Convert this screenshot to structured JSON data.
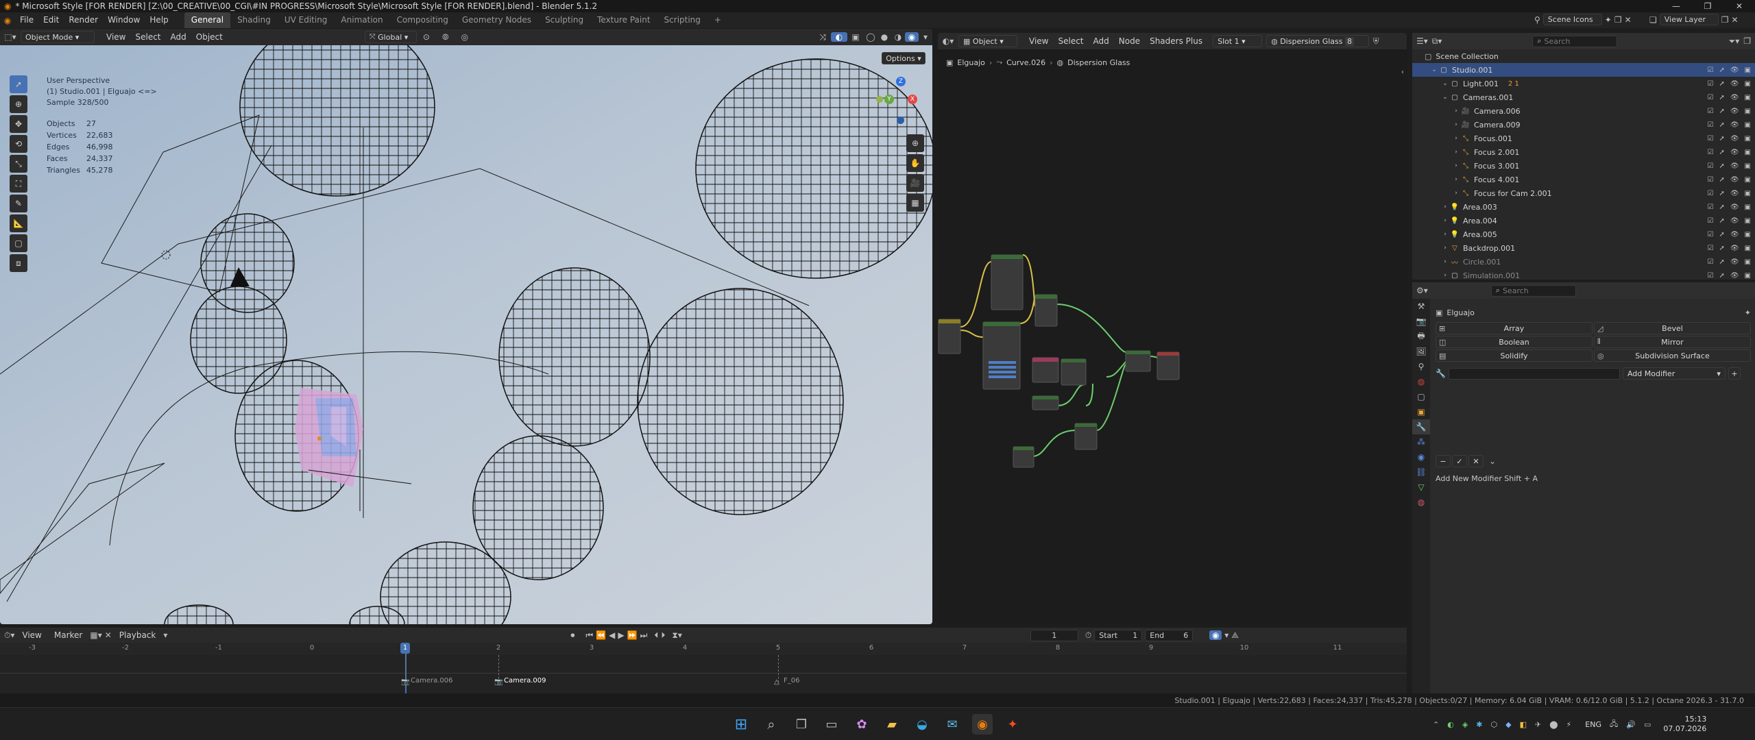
{
  "window": {
    "title": "* Microsoft Style [FOR RENDER] [Z:\\00_CREATIVE\\00_CGI\\#IN PROGRESS\\Microsoft Style\\Microsoft Style [FOR RENDER].blend] - Blender 5.1.2",
    "controls": [
      "—",
      "❐",
      "✕"
    ]
  },
  "menubar": {
    "items": [
      "File",
      "Edit",
      "Render",
      "Window",
      "Help"
    ],
    "workspaces": [
      "General",
      "Shading",
      "UV Editing",
      "Animation",
      "Compositing",
      "Geometry Nodes",
      "Sculpting",
      "Texture Paint",
      "Scripting"
    ],
    "active_workspace": "General",
    "add_workspace": "+",
    "scene": "Scene Icons",
    "view_layer": "View Layer"
  },
  "viewport": {
    "mode": "Object Mode",
    "menus": [
      "View",
      "Select",
      "Add",
      "Object"
    ],
    "orientation": "Global",
    "options": "Options",
    "overlay_lines": [
      "User Perspective",
      "(1) Studio.001 | Elguajo <=>",
      "Sample 328/500"
    ],
    "stats": [
      {
        "label": "Objects",
        "value": "27"
      },
      {
        "label": "Vertices",
        "value": "22,683"
      },
      {
        "label": "Edges",
        "value": "46,998"
      },
      {
        "label": "Faces",
        "value": "24,337"
      },
      {
        "label": "Triangles",
        "value": "45,278"
      }
    ],
    "gizmo_axes": [
      "Z",
      "Y",
      "X"
    ]
  },
  "node_editor": {
    "type": "Object",
    "menus": [
      "View",
      "Select",
      "Add",
      "Node",
      "Shaders Plus"
    ],
    "slot": "Slot 1",
    "material": "Dispersion Glass",
    "user_count": "8",
    "breadcrumb": [
      "Elguajo",
      "Curve.026",
      "Dispersion Glass"
    ]
  },
  "outliner": {
    "search_placeholder": "Search",
    "scene_collection": "Scene Collection",
    "rows": [
      {
        "name": "Studio.001",
        "indent": 1,
        "type": "collection"
      },
      {
        "name": "Light.001",
        "indent": 2,
        "type": "collection",
        "extra": "2 1"
      },
      {
        "name": "Cameras.001",
        "indent": 2,
        "type": "collection"
      },
      {
        "name": "Camera.006",
        "indent": 3,
        "type": "camera"
      },
      {
        "name": "Camera.009",
        "indent": 3,
        "type": "camera"
      },
      {
        "name": "Focus.001",
        "indent": 3,
        "type": "empty"
      },
      {
        "name": "Focus 2.001",
        "indent": 3,
        "type": "empty"
      },
      {
        "name": "Focus 3.001",
        "indent": 3,
        "type": "empty"
      },
      {
        "name": "Focus 4.001",
        "indent": 3,
        "type": "empty"
      },
      {
        "name": "Focus for Cam 2.001",
        "indent": 3,
        "type": "empty"
      },
      {
        "name": "Area.003",
        "indent": 2,
        "type": "light"
      },
      {
        "name": "Area.004",
        "indent": 2,
        "type": "light"
      },
      {
        "name": "Area.005",
        "indent": 2,
        "type": "light"
      },
      {
        "name": "Backdrop.001",
        "indent": 2,
        "type": "mesh"
      },
      {
        "name": "Circle.001",
        "indent": 2,
        "type": "curve"
      },
      {
        "name": "Simulation.001",
        "indent": 2,
        "type": "collection"
      }
    ]
  },
  "properties": {
    "search_placeholder": "Search",
    "object_name": "Elguajo",
    "modifier_buttons": [
      {
        "label": "Array",
        "icon": "array-icon"
      },
      {
        "label": "Bevel",
        "icon": "bevel-icon"
      },
      {
        "label": "Boolean",
        "icon": "boolean-icon"
      },
      {
        "label": "Mirror",
        "icon": "mirror-icon"
      },
      {
        "label": "Solidify",
        "icon": "solidify-icon"
      },
      {
        "label": "Subdivision Surface",
        "icon": "subdivision-icon"
      }
    ],
    "add_modifier": "Add Modifier",
    "hint": "Add New Modifier Shift + A"
  },
  "timeline": {
    "menus": [
      "View",
      "Marker",
      "Playback"
    ],
    "current_frame": "1",
    "start_label": "Start",
    "start": "1",
    "end_label": "End",
    "end": "6",
    "ruler": [
      "-3",
      "-2",
      "-1",
      "0",
      "1",
      "2",
      "3",
      "4",
      "5",
      "6",
      "7",
      "8",
      "9",
      "10",
      "11"
    ],
    "markers": [
      "Camera.006",
      "Camera.009",
      "F_06"
    ]
  },
  "statusbar": {
    "text": "Studio.001 | Elguajo | Verts:22,683 | Faces:24,337 | Tris:45,278 | Objects:0/27 | Memory: 6.04 GiB | VRAM: 0.6/12.0 GiB | 5.1.2 | Octane 2026.3 - 31.7.0"
  },
  "taskbar": {
    "language": "ENG",
    "time": "15:13",
    "date": "07.07.2026"
  }
}
